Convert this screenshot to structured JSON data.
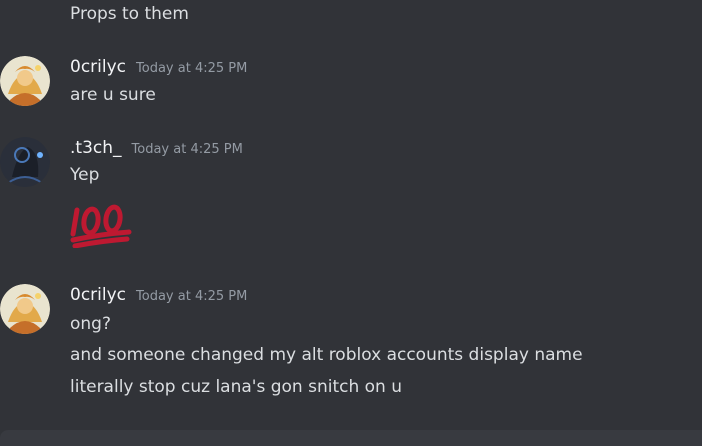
{
  "messages": [
    {
      "continuation": true,
      "text": "Props to them"
    },
    {
      "author": "0crilyc",
      "timestamp": "Today at 4:25 PM",
      "avatar_icon": "anime-character-avatar",
      "lines": [
        "are u sure"
      ]
    },
    {
      "author": ".t3ch_",
      "timestamp": "Today at 4:25 PM",
      "avatar_icon": "dark-creature-avatar",
      "lines": [
        "Yep"
      ],
      "emoji": "hundred-points-emoji"
    },
    {
      "author": "0crilyc",
      "timestamp": "Today at 4:25 PM",
      "avatar_icon": "anime-character-avatar",
      "lines": [
        "ong?",
        "and someone changed my alt roblox accounts display name",
        "literally stop cuz lana's gon snitch on u"
      ]
    }
  ],
  "colors": {
    "background": "#313338",
    "text": "#dbdee1",
    "username": "#f2f3f5",
    "timestamp": "#949ba4",
    "emoji_red": "#be1931"
  }
}
